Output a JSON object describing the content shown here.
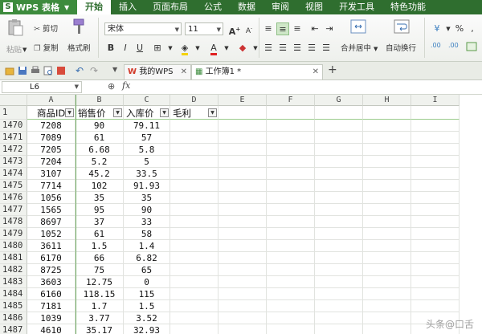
{
  "app": {
    "title": "WPS 表格",
    "logo_letter": "S"
  },
  "menu": [
    {
      "label": "开始",
      "active": true
    },
    {
      "label": "插入"
    },
    {
      "label": "页面布局"
    },
    {
      "label": "公式"
    },
    {
      "label": "数据"
    },
    {
      "label": "审阅"
    },
    {
      "label": "视图"
    },
    {
      "label": "开发工具"
    },
    {
      "label": "特色功能"
    }
  ],
  "ribbon": {
    "paste_label": "粘贴",
    "cut_label": "剪切",
    "copy_label": "复制",
    "format_painter_label": "格式刷",
    "font_name": "宋体",
    "font_size": "11",
    "merge_center_label": "合并居中",
    "wrap_text_label": "自动换行",
    "number_format_symbol": "%",
    "decimal_increase_label": ".00",
    "decimal_decrease_label": ".00"
  },
  "tabs": [
    {
      "label": "我的WPS"
    },
    {
      "label": "工作簿1 *"
    }
  ],
  "formula_bar": {
    "cell_ref": "L6",
    "fx": "fx"
  },
  "columns": [
    "A",
    "B",
    "C",
    "D",
    "E",
    "F",
    "G",
    "H",
    "I"
  ],
  "header_row": {
    "row_num": "1",
    "cells": [
      "商品ID",
      "销售价",
      "入库价",
      "毛利"
    ]
  },
  "rows": [
    {
      "n": "1470",
      "a": "7208",
      "b": "90",
      "c": "79.11"
    },
    {
      "n": "1471",
      "a": "7089",
      "b": "61",
      "c": "57"
    },
    {
      "n": "1472",
      "a": "7205",
      "b": "6.68",
      "c": "5.8"
    },
    {
      "n": "1473",
      "a": "7204",
      "b": "5.2",
      "c": "5"
    },
    {
      "n": "1474",
      "a": "3107",
      "b": "45.2",
      "c": "33.5"
    },
    {
      "n": "1475",
      "a": "7714",
      "b": "102",
      "c": "91.93"
    },
    {
      "n": "1476",
      "a": "1056",
      "b": "35",
      "c": "35"
    },
    {
      "n": "1477",
      "a": "1565",
      "b": "95",
      "c": "90"
    },
    {
      "n": "1478",
      "a": "8697",
      "b": "37",
      "c": "33"
    },
    {
      "n": "1479",
      "a": "1052",
      "b": "61",
      "c": "58"
    },
    {
      "n": "1480",
      "a": "3611",
      "b": "1.5",
      "c": "1.4"
    },
    {
      "n": "1481",
      "a": "6170",
      "b": "66",
      "c": "6.82"
    },
    {
      "n": "1482",
      "a": "8725",
      "b": "75",
      "c": "65"
    },
    {
      "n": "1483",
      "a": "3603",
      "b": "12.75",
      "c": "0"
    },
    {
      "n": "1484",
      "a": "6160",
      "b": "118.15",
      "c": "115"
    },
    {
      "n": "1485",
      "a": "7181",
      "b": "1.7",
      "c": "1.5"
    },
    {
      "n": "1486",
      "a": "1039",
      "b": "3.77",
      "c": "3.52"
    },
    {
      "n": "1487",
      "a": "4610",
      "b": "35.17",
      "c": "32.93"
    }
  ],
  "watermark": "头条@口舌"
}
